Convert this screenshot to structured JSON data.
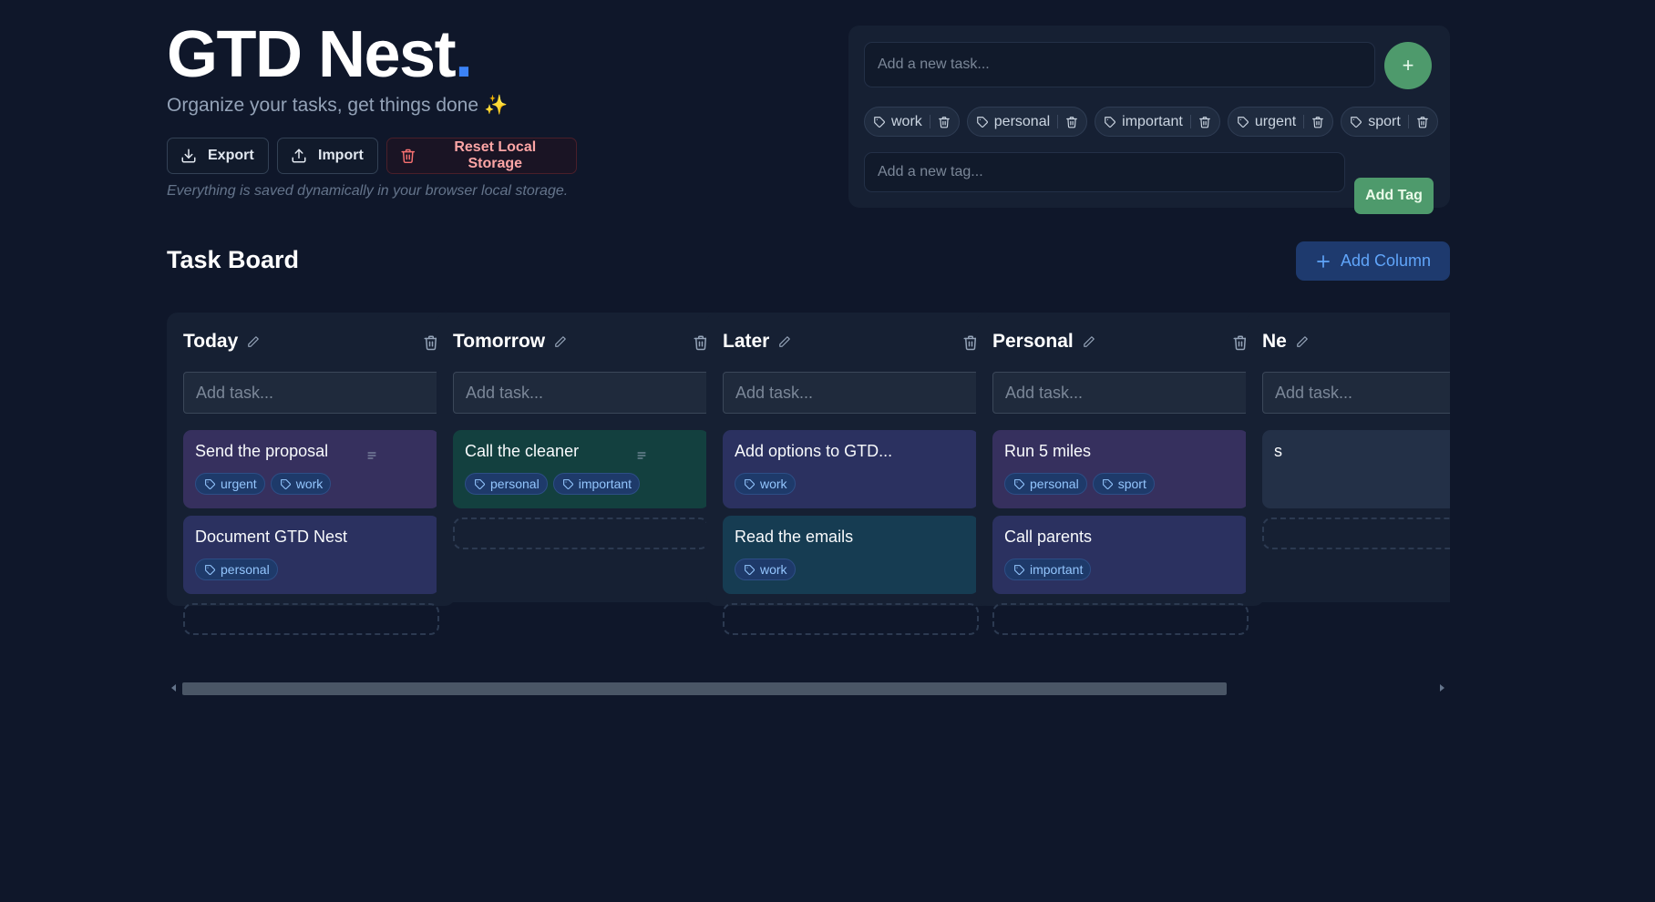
{
  "header": {
    "brand_main": "GTD Nest",
    "brand_dot": ".",
    "subtitle": "Organize your tasks, get things done",
    "subtitle_emoji": "✨",
    "export_label": "Export",
    "import_label": "Import",
    "reset_label": "Reset Local Storage",
    "storage_note": "Everything is saved dynamically in your browser local storage."
  },
  "quick_add": {
    "task_placeholder": "Add a new task...",
    "add_task_symbol": "+",
    "tags": [
      "work",
      "personal",
      "important",
      "urgent",
      "sport"
    ],
    "tag_placeholder": "Add a new tag...",
    "add_tag_label": "Add Tag"
  },
  "board": {
    "title": "Task Board",
    "add_column_label": "Add Column",
    "column_add_placeholder": "Add task...",
    "columns": [
      {
        "title": "Today",
        "cards": [
          {
            "title": "Send the proposal",
            "tags": [
              "urgent",
              "work"
            ],
            "has_notes": true,
            "color": "#36305e"
          },
          {
            "title": "Document GTD Nest",
            "tags": [
              "personal"
            ],
            "has_notes": false,
            "color": "#2b3160"
          }
        ]
      },
      {
        "title": "Tomorrow",
        "cards": [
          {
            "title": "Call the cleaner",
            "tags": [
              "personal",
              "important"
            ],
            "has_notes": true,
            "color": "#13403f"
          }
        ]
      },
      {
        "title": "Later",
        "cards": [
          {
            "title": "Add options to GTD...",
            "tags": [
              "work"
            ],
            "has_notes": false,
            "color": "#2b3160"
          },
          {
            "title": "Read the emails",
            "tags": [
              "work"
            ],
            "has_notes": false,
            "color": "#163c52"
          }
        ]
      },
      {
        "title": "Personal",
        "cards": [
          {
            "title": "Run 5 miles",
            "tags": [
              "personal",
              "sport"
            ],
            "has_notes": false,
            "color": "#36305e"
          },
          {
            "title": "Call parents",
            "tags": [
              "important"
            ],
            "has_notes": false,
            "color": "#2b3160"
          }
        ]
      },
      {
        "title": "Ne",
        "cards": [
          {
            "title": "s",
            "tags": [],
            "has_notes": false,
            "color": "#233047"
          }
        ]
      }
    ]
  },
  "colors": {
    "background": "#0f172a",
    "accent_blue": "#3b82f6",
    "accent_green": "#4e9a6c",
    "danger": "#fca5a5"
  }
}
